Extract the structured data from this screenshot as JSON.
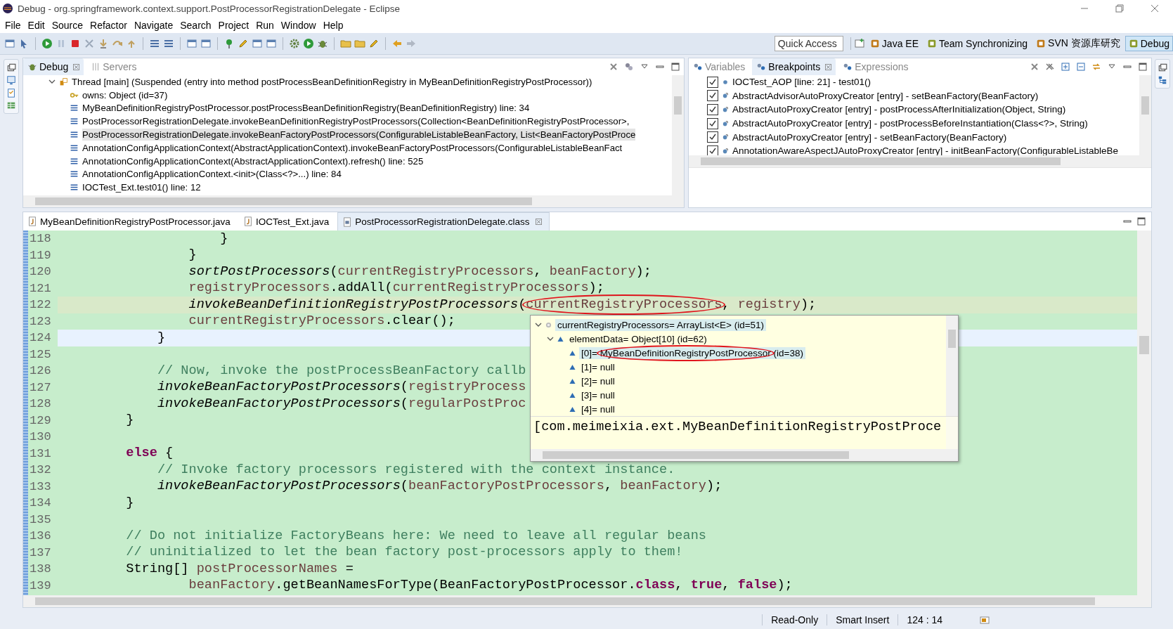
{
  "window": {
    "title": "Debug - org.springframework.context.support.PostProcessorRegistrationDelegate - Eclipse"
  },
  "menu": [
    "File",
    "Edit",
    "Source",
    "Refactor",
    "Navigate",
    "Search",
    "Project",
    "Run",
    "Window",
    "Help"
  ],
  "toolbar": {
    "quick_access": {
      "placeholder": "Quick Access"
    },
    "perspectives": [
      {
        "label": "Java EE",
        "selected": false
      },
      {
        "label": "Team Synchronizing",
        "selected": false
      },
      {
        "label": "SVN 资源库研究",
        "selected": false
      },
      {
        "label": "Debug",
        "selected": true
      }
    ]
  },
  "debug_view": {
    "tabs": [
      {
        "label": "Debug",
        "selected": true,
        "closable": true
      },
      {
        "label": "Servers",
        "selected": false,
        "closable": false
      }
    ],
    "frames": [
      {
        "kind": "thread",
        "text": "Thread [main] (Suspended (entry into method postProcessBeanDefinitionRegistry in MyBeanDefinitionRegistryPostProcessor))",
        "selected": false
      },
      {
        "kind": "monitor",
        "text": "owns: Object  (id=37)",
        "selected": false
      },
      {
        "kind": "frame",
        "text": "MyBeanDefinitionRegistryPostProcessor.postProcessBeanDefinitionRegistry(BeanDefinitionRegistry) line: 34",
        "selected": false
      },
      {
        "kind": "frame",
        "text": "PostProcessorRegistrationDelegate.invokeBeanDefinitionRegistryPostProcessors(Collection<BeanDefinitionRegistryPostProcessor>,",
        "selected": false
      },
      {
        "kind": "frame",
        "text": "PostProcessorRegistrationDelegate.invokeBeanFactoryPostProcessors(ConfigurableListableBeanFactory, List<BeanFactoryPostProce",
        "selected": true
      },
      {
        "kind": "frame",
        "text": "AnnotationConfigApplicationContext(AbstractApplicationContext).invokeBeanFactoryPostProcessors(ConfigurableListableBeanFact",
        "selected": false
      },
      {
        "kind": "frame",
        "text": "AnnotationConfigApplicationContext(AbstractApplicationContext).refresh() line: 525",
        "selected": false
      },
      {
        "kind": "frame",
        "text": "AnnotationConfigApplicationContext.<init>(Class<?>...) line: 84",
        "selected": false
      },
      {
        "kind": "frame",
        "text": "IOCTest_Ext.test01() line: 12",
        "selected": false
      }
    ]
  },
  "breakpoints_view": {
    "tabs": [
      {
        "label": "Variables",
        "selected": false,
        "closable": false
      },
      {
        "label": "Breakpoints",
        "selected": true,
        "closable": true
      },
      {
        "label": "Expressions",
        "selected": false,
        "closable": false
      }
    ],
    "items": [
      {
        "kind": "line",
        "text": "IOCTest_AOP [line: 21] - test01()",
        "checked": true
      },
      {
        "kind": "method",
        "text": "AbstractAdvisorAutoProxyCreator [entry] - setBeanFactory(BeanFactory)",
        "checked": true
      },
      {
        "kind": "method",
        "text": "AbstractAutoProxyCreator [entry] - postProcessAfterInitialization(Object, String)",
        "checked": true
      },
      {
        "kind": "method",
        "text": "AbstractAutoProxyCreator [entry] - postProcessBeforeInstantiation(Class<?>, String)",
        "checked": true
      },
      {
        "kind": "method",
        "text": "AbstractAutoProxyCreator [entry] - setBeanFactory(BeanFactory)",
        "checked": true
      },
      {
        "kind": "method",
        "text": "AnnotationAwareAspectJAutoProxyCreator [entry] - initBeanFactory(ConfigurableListableBe",
        "checked": true
      }
    ]
  },
  "editor": {
    "tabs": [
      {
        "label": "MyBeanDefinitionRegistryPostProcessor.java",
        "kind": "java",
        "selected": false,
        "closable": false
      },
      {
        "label": "IOCTest_Ext.java",
        "kind": "java",
        "selected": false,
        "closable": false
      },
      {
        "label": "PostProcessorRegistrationDelegate.class",
        "kind": "class",
        "selected": true,
        "closable": true
      }
    ],
    "lines": [
      {
        "number": "118",
        "kind": "normal",
        "segments": [
          {
            "kind": "plain",
            "text": "                    }"
          }
        ]
      },
      {
        "number": "119",
        "kind": "normal",
        "segments": [
          {
            "kind": "plain",
            "text": "                }"
          }
        ]
      },
      {
        "number": "120",
        "kind": "normal",
        "segments": [
          {
            "kind": "method",
            "text": "                sortPostProcessors"
          },
          {
            "kind": "plain",
            "text": "("
          },
          {
            "kind": "var",
            "text": "currentRegistryProcessors"
          },
          {
            "kind": "plain",
            "text": ", "
          },
          {
            "kind": "var",
            "text": "beanFactory"
          },
          {
            "kind": "plain",
            "text": ");"
          }
        ]
      },
      {
        "number": "121",
        "kind": "normal",
        "segments": [
          {
            "kind": "var",
            "text": "                registryProcessors"
          },
          {
            "kind": "plain",
            "text": ".addAll("
          },
          {
            "kind": "var",
            "text": "currentRegistryProcessors"
          },
          {
            "kind": "plain",
            "text": ");"
          }
        ]
      },
      {
        "number": "122",
        "kind": "current",
        "segments": [
          {
            "kind": "method",
            "text": "                invokeBeanDefinitionRegistryPostProcessors"
          },
          {
            "kind": "plain",
            "text": "("
          },
          {
            "kind": "var",
            "text": "currentRegistryProcessors",
            "circled": true
          },
          {
            "kind": "plain",
            "text": ", "
          },
          {
            "kind": "var",
            "text": "registry"
          },
          {
            "kind": "plain",
            "text": ");"
          }
        ]
      },
      {
        "number": "123",
        "kind": "normal",
        "segments": [
          {
            "kind": "var",
            "text": "                currentRegistryProcessors"
          },
          {
            "kind": "plain",
            "text": ".clear();"
          }
        ]
      },
      {
        "number": "124",
        "kind": "cursor",
        "segments": [
          {
            "kind": "plain",
            "text": "            }"
          }
        ]
      },
      {
        "number": "125",
        "kind": "normal"
      },
      {
        "number": "126",
        "kind": "normal",
        "segments": [
          {
            "kind": "comment",
            "text": "            // Now, invoke the postProcessBeanFactory callb"
          }
        ]
      },
      {
        "number": "127",
        "kind": "normal",
        "segments": [
          {
            "kind": "method",
            "text": "            invokeBeanFactoryPostProcessors"
          },
          {
            "kind": "plain",
            "text": "("
          },
          {
            "kind": "var",
            "text": "registryProcess"
          }
        ]
      },
      {
        "number": "128",
        "kind": "normal",
        "segments": [
          {
            "kind": "method",
            "text": "            invokeBeanFactoryPostProcessors"
          },
          {
            "kind": "plain",
            "text": "("
          },
          {
            "kind": "var",
            "text": "regularPostProc"
          }
        ]
      },
      {
        "number": "129",
        "kind": "normal",
        "segments": [
          {
            "kind": "plain",
            "text": "        }"
          }
        ]
      },
      {
        "number": "130",
        "kind": "normal"
      },
      {
        "number": "131",
        "kind": "normal",
        "segments": [
          {
            "kind": "keyword",
            "text": "        else"
          },
          {
            "kind": "plain",
            "text": " {"
          }
        ]
      },
      {
        "number": "132",
        "kind": "normal",
        "segments": [
          {
            "kind": "comment",
            "text": "            // Invoke factory processors registered with the context instance."
          }
        ]
      },
      {
        "number": "133",
        "kind": "normal",
        "segments": [
          {
            "kind": "method",
            "text": "            invokeBeanFactoryPostProcessors"
          },
          {
            "kind": "plain",
            "text": "("
          },
          {
            "kind": "var",
            "text": "beanFactoryPostProcessors"
          },
          {
            "kind": "plain",
            "text": ", "
          },
          {
            "kind": "var",
            "text": "beanFactory"
          },
          {
            "kind": "plain",
            "text": ");"
          }
        ]
      },
      {
        "number": "134",
        "kind": "normal",
        "segments": [
          {
            "kind": "plain",
            "text": "        }"
          }
        ]
      },
      {
        "number": "135",
        "kind": "normal"
      },
      {
        "number": "136",
        "kind": "normal",
        "segments": [
          {
            "kind": "comment",
            "text": "        // Do not initialize FactoryBeans here: We need to leave all regular beans"
          }
        ]
      },
      {
        "number": "137",
        "kind": "normal",
        "segments": [
          {
            "kind": "comment",
            "text": "        // uninitialized to let the bean factory post-processors apply to them!"
          }
        ]
      },
      {
        "number": "138",
        "kind": "normal",
        "segments": [
          {
            "kind": "plain",
            "text": "        String[] "
          },
          {
            "kind": "var",
            "text": "postProcessorNames"
          },
          {
            "kind": "plain",
            "text": " ="
          }
        ]
      },
      {
        "number": "139",
        "kind": "normal",
        "segments": [
          {
            "kind": "var",
            "text": "                beanFactory"
          },
          {
            "kind": "plain",
            "text": ".getBeanNamesForType(BeanFactoryPostProcessor."
          },
          {
            "kind": "keyword",
            "text": "class"
          },
          {
            "kind": "plain",
            "text": ", "
          },
          {
            "kind": "keyword",
            "text": "true"
          },
          {
            "kind": "plain",
            "text": ", "
          },
          {
            "kind": "keyword",
            "text": "false"
          },
          {
            "kind": "plain",
            "text": ");"
          }
        ]
      }
    ]
  },
  "popup": {
    "tree": [
      {
        "kind": "local",
        "label": "currentRegistryProcessors= ArrayList<E>  (id=51)",
        "expanded": true,
        "selected": true,
        "children": [
          {
            "kind": "field",
            "label": "elementData= Object[10]  (id=62)",
            "expanded": true,
            "selected": false,
            "children": [
              {
                "kind": "field",
                "label": "[0]= ",
                "value": "MyBeanDefinitionRegistryPostProcessor",
                "suffix": " (id=38)",
                "circled": true,
                "selected": true
              },
              {
                "kind": "field",
                "label": "[1]= null",
                "selected": false
              },
              {
                "kind": "field",
                "label": "[2]= null",
                "selected": false
              },
              {
                "kind": "field",
                "label": "[3]= null",
                "selected": false
              },
              {
                "kind": "field",
                "label": "[4]= null",
                "selected": false
              }
            ]
          }
        ]
      }
    ],
    "detail": "[com.meimeixia.ext.MyBeanDefinitionRegistryPostProce"
  },
  "status_bar": {
    "mode": "Read-Only",
    "insert": "Smart Insert",
    "position": "124 : 14"
  }
}
